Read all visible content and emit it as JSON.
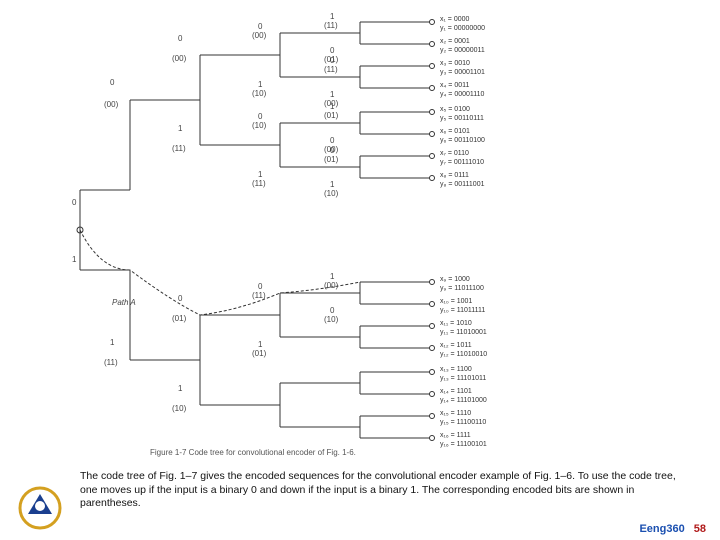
{
  "root": {
    "input0": "0",
    "input1": "1"
  },
  "level1": [
    {
      "label": "0",
      "code": "(00)"
    },
    {
      "label": "1",
      "code": "(11)"
    }
  ],
  "level2": [
    {
      "label": "0",
      "code": "(00)"
    },
    {
      "label": "1",
      "code": "(11)"
    },
    {
      "label": "0",
      "code": "(01)"
    },
    {
      "label": "1",
      "code": "(10)"
    }
  ],
  "path_label": "Path A",
  "leaves": [
    {
      "x": "x₁ = 0000",
      "y": "y₁ = 00000000"
    },
    {
      "x": "x₂ = 0001",
      "y": "y₂ = 00000011"
    },
    {
      "x": "x₃ = 0010",
      "y": "y₃ = 00001101"
    },
    {
      "x": "x₄ = 0011",
      "y": "y₄ = 00001110"
    },
    {
      "x": "x₅ = 0100",
      "y": "y₅ = 00110111"
    },
    {
      "x": "x₆ = 0101",
      "y": "y₆ = 00110100"
    },
    {
      "x": "x₇ = 0110",
      "y": "y₇ = 00111010"
    },
    {
      "x": "x₈ = 0111",
      "y": "y₈ = 00111001"
    },
    {
      "x": "x₉ = 1000",
      "y": "y₉ = 11011100"
    },
    {
      "x": "x₁₀ = 1001",
      "y": "y₁₀ = 11011111"
    },
    {
      "x": "x₁₁ = 1010",
      "y": "y₁₁ = 11010001"
    },
    {
      "x": "x₁₂ = 1011",
      "y": "y₁₂ = 11010010"
    },
    {
      "x": "x₁₃ = 1100",
      "y": "y₁₃ = 11101011"
    },
    {
      "x": "x₁₄ = 1101",
      "y": "y₁₄ = 11101000"
    },
    {
      "x": "x₁₅ = 1110",
      "y": "y₁₅ = 11100110"
    },
    {
      "x": "x₁₆ = 1111",
      "y": "y₁₆ = 11100101"
    }
  ],
  "branch_labels": [
    "0",
    "(00)",
    "1",
    "(11)",
    "0",
    "(01)",
    "1",
    "(10)",
    "0",
    "(11)",
    "1",
    "(00)",
    "0",
    "(10)",
    "1",
    "(01)",
    "0",
    "(00)",
    "1",
    "(11)",
    "0",
    "(01)",
    "1",
    "(10)",
    "0",
    "(11)",
    "1",
    "(00)",
    "0",
    "(10)",
    "1",
    "(01)"
  ],
  "caption": "Figure 1-7  Code tree for convolutional encoder of Fig. 1-6.",
  "body": "The code tree of Fig. 1–7 gives the encoded sequences for the convolutional encoder example of Fig. 1–6. To use the code tree, one moves up if the input is a binary 0 and down if the input is a binary 1. The corresponding encoded bits are shown in parentheses.",
  "footer": {
    "course": "Eeng360",
    "page": "58"
  }
}
